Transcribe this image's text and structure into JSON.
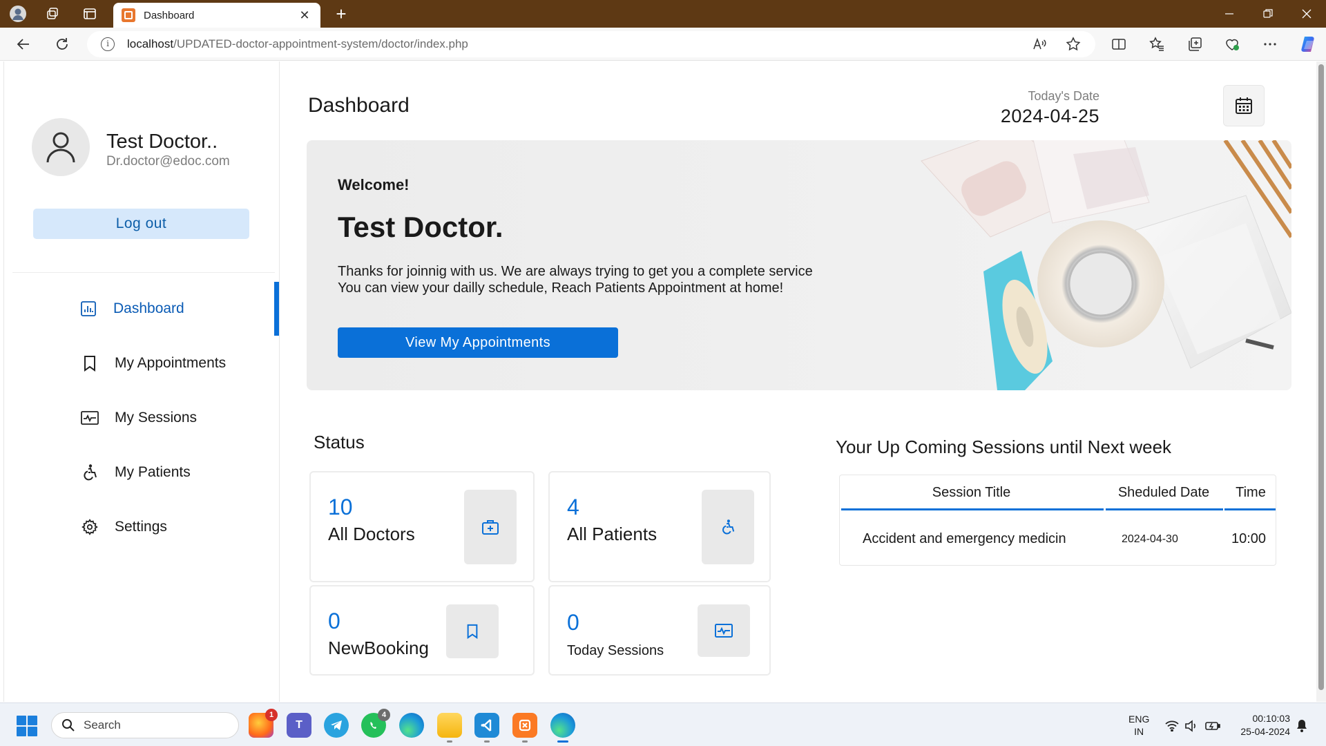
{
  "browser": {
    "tab_title": "Dashboard",
    "url_host": "localhost",
    "url_path": "/UPDATED-doctor-appointment-system/doctor/index.php"
  },
  "sidebar": {
    "profile_name": "Test Doctor..",
    "profile_email": "Dr.doctor@edoc.com",
    "logout_label": "Log out",
    "menu": [
      {
        "label": "Dashboard",
        "icon": "dashboard-icon",
        "active": true
      },
      {
        "label": "My Appointments",
        "icon": "bookmark-icon",
        "active": false
      },
      {
        "label": "My Sessions",
        "icon": "session-icon",
        "active": false
      },
      {
        "label": "My Patients",
        "icon": "patient-icon",
        "active": false
      },
      {
        "label": "Settings",
        "icon": "gear-icon",
        "active": false
      }
    ]
  },
  "main": {
    "title": "Dashboard",
    "date_label": "Today's Date",
    "date_value": "2024-04-25",
    "hero": {
      "welcome": "Welcome!",
      "name": "Test Doctor.",
      "line1": "Thanks for joinnig with us. We are always trying to get you a complete service",
      "line2": "You can view your dailly schedule, Reach Patients Appointment at home!",
      "button": "View My Appointments"
    },
    "status_title": "Status",
    "stats": [
      {
        "value": "10",
        "label": "All Doctors",
        "icon": "doctor-kit-icon"
      },
      {
        "value": "4",
        "label": "All Patients",
        "icon": "patient-icon"
      },
      {
        "value": "0",
        "label": "NewBooking",
        "icon": "bookmark-icon"
      },
      {
        "value": "0",
        "label": "Today Sessions",
        "icon": "session-icon"
      }
    ],
    "sessions_title": "Your Up Coming Sessions until Next week",
    "sessions_table": {
      "headers": [
        "Session Title",
        "Sheduled Date",
        "Time"
      ],
      "rows": [
        {
          "title": "Accident and emergency medicin",
          "date": "2024-04-30",
          "time": "10:00"
        }
      ]
    }
  },
  "taskbar": {
    "search_placeholder": "Search",
    "apps": [
      {
        "name": "firefox",
        "badge": "1"
      },
      {
        "name": "teams",
        "badge": ""
      },
      {
        "name": "telegram",
        "badge": ""
      },
      {
        "name": "whatsapp",
        "badge": "4"
      },
      {
        "name": "edge",
        "badge": ""
      },
      {
        "name": "file-explorer",
        "badge": ""
      },
      {
        "name": "vscode",
        "badge": ""
      },
      {
        "name": "xampp",
        "badge": ""
      },
      {
        "name": "edge-active",
        "badge": ""
      }
    ],
    "lang_top": "ENG",
    "lang_bottom": "IN",
    "time": "00:10:03",
    "date": "25-04-2024"
  },
  "colors": {
    "accent": "#0a70d8",
    "titlebar": "#5e3914",
    "logout_bg": "#d6e8fb"
  }
}
